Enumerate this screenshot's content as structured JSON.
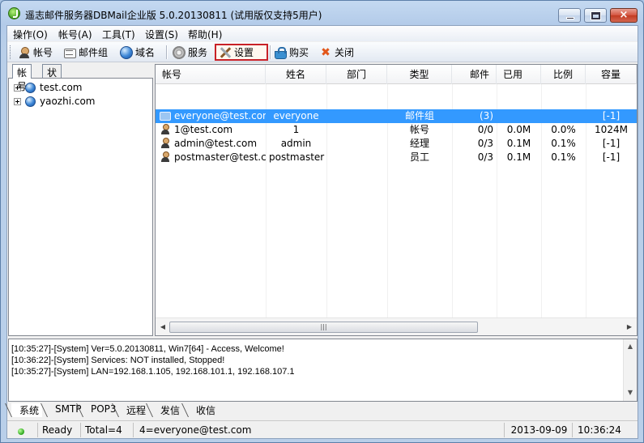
{
  "title": "遥志邮件服务器DBMail企业版 5.0.20130811 (试用版仅支持5用户)",
  "window_buttons": {
    "close": "×"
  },
  "menu": [
    "操作(O)",
    "帐号(A)",
    "工具(T)",
    "设置(S)",
    "帮助(H)"
  ],
  "toolbar": {
    "account": "帐号",
    "mailgroup": "邮件组",
    "domain": "域名",
    "service": "服务",
    "settings": "设置",
    "buy": "购买",
    "close": "关闭",
    "close_glyph": "✖"
  },
  "left_tabs": [
    "帐号",
    "状态"
  ],
  "tree": [
    "test.com",
    "yaozhi.com"
  ],
  "columns": [
    "帐号",
    "姓名",
    "部门",
    "类型",
    "邮件",
    "已用",
    "比例",
    "容量"
  ],
  "rows": [
    {
      "account": "everyone@test.com",
      "name": "everyone",
      "dept": "",
      "type": "邮件组",
      "mail": "(3)",
      "used": "",
      "ratio": "",
      "capacity": "[-1]",
      "icon": "group-icon",
      "selected": true
    },
    {
      "account": "1@test.com",
      "name": "1",
      "dept": "",
      "type": "帐号",
      "mail": "0/0",
      "used": "0.0M",
      "ratio": "0.0%",
      "capacity": "1024M",
      "icon": "user-icon",
      "selected": false
    },
    {
      "account": "admin@test.com",
      "name": "admin",
      "dept": "",
      "type": "经理",
      "mail": "0/3",
      "used": "0.1M",
      "ratio": "0.1%",
      "capacity": "[-1]",
      "icon": "user-icon",
      "selected": false
    },
    {
      "account": "postmaster@test.com",
      "name": "postmaster",
      "dept": "",
      "type": "员工",
      "mail": "0/3",
      "used": "0.1M",
      "ratio": "0.1%",
      "capacity": "[-1]",
      "icon": "user-icon",
      "selected": false
    }
  ],
  "scroll": {
    "left": "◀",
    "right": "▶",
    "thumb": "|||",
    "up": "▲",
    "down": "▼"
  },
  "log": [
    "[10:35:27]-[System] Ver=5.0.20130811, Win7[64] - Access, Welcome!",
    "[10:36:22]-[System] Services: NOT installed, Stopped!",
    "[10:35:27]-[System] LAN=192.168.1.105, 192.168.101.1, 192.168.107.1"
  ],
  "bottom_tabs": [
    "系统",
    "SMTP",
    "POP3",
    "远程",
    "发信",
    "收信"
  ],
  "status": {
    "ready": "Ready",
    "total": "Total=4",
    "selected": "4=everyone@test.com",
    "date": "2013-09-09",
    "time": "10:36:24"
  },
  "colors": {
    "selection": "#3399ff",
    "highlight_border": "#c82127"
  }
}
